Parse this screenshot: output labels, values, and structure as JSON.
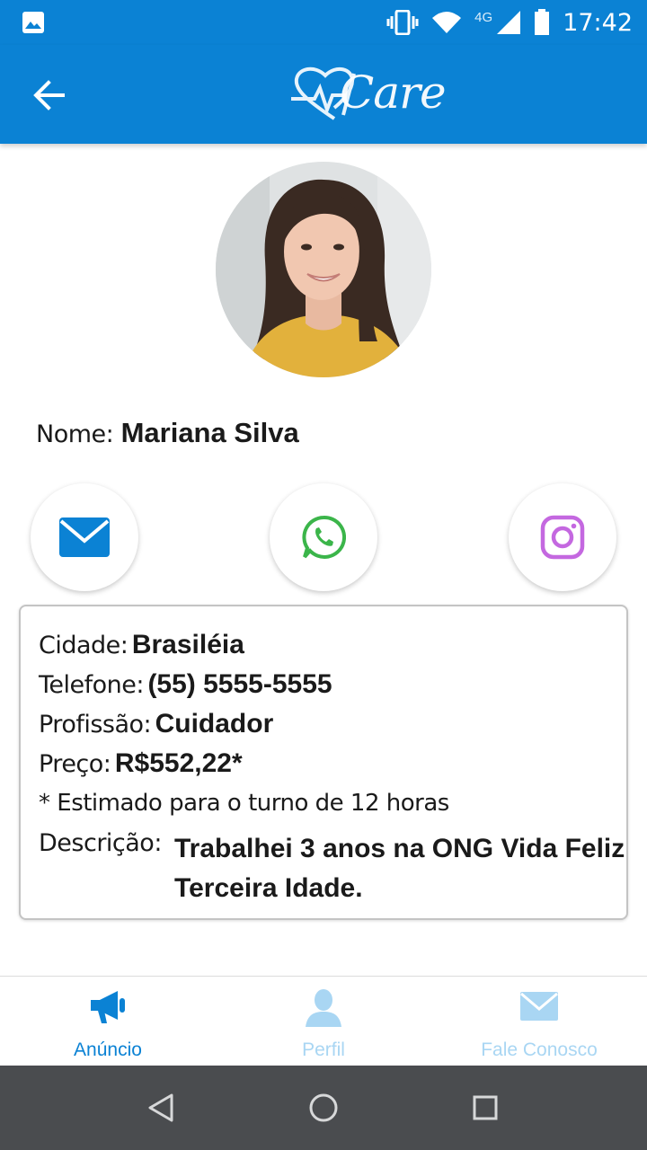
{
  "status_bar": {
    "time": "17:42",
    "network": "4G",
    "icons": [
      "gallery-icon",
      "vibrate-icon",
      "wifi-icon",
      "signal-icon",
      "battery-icon"
    ]
  },
  "app_bar": {
    "logo_text": "Care",
    "back_icon": "arrow-left-icon"
  },
  "profile": {
    "name_label": "Nome:",
    "name_value": "Mariana Silva"
  },
  "contacts": [
    {
      "icon": "email-icon",
      "color": "#0b82d4"
    },
    {
      "icon": "whatsapp-icon",
      "color": "#3bb54a"
    },
    {
      "icon": "instagram-icon",
      "color": "#c468e0"
    }
  ],
  "details": {
    "city_label": "Cidade:",
    "city_value": "Brasiléia",
    "phone_label": "Telefone:",
    "phone_value": "(55) 5555-5555",
    "profession_label": "Profissão:",
    "profession_value": "Cuidador",
    "price_label": "Preço:",
    "price_value": "R$552,22*",
    "price_note": "* Estimado para o turno de 12 horas",
    "description_label": "Descrição:",
    "description_line1": "Trabalhei 3 anos na ONG Vida Feliz",
    "description_line2": "Terceira Idade."
  },
  "bottom_nav": {
    "items": [
      {
        "label": "Anúncio",
        "icon": "megaphone-icon",
        "active": true
      },
      {
        "label": "Perfil",
        "icon": "person-icon",
        "active": false
      },
      {
        "label": "Fale Conosco",
        "icon": "envelope-icon",
        "active": false
      }
    ]
  },
  "colors": {
    "primary": "#0b82d4",
    "inactive_nav": "#a9d6f3",
    "system_nav": "#4a4c4f"
  }
}
